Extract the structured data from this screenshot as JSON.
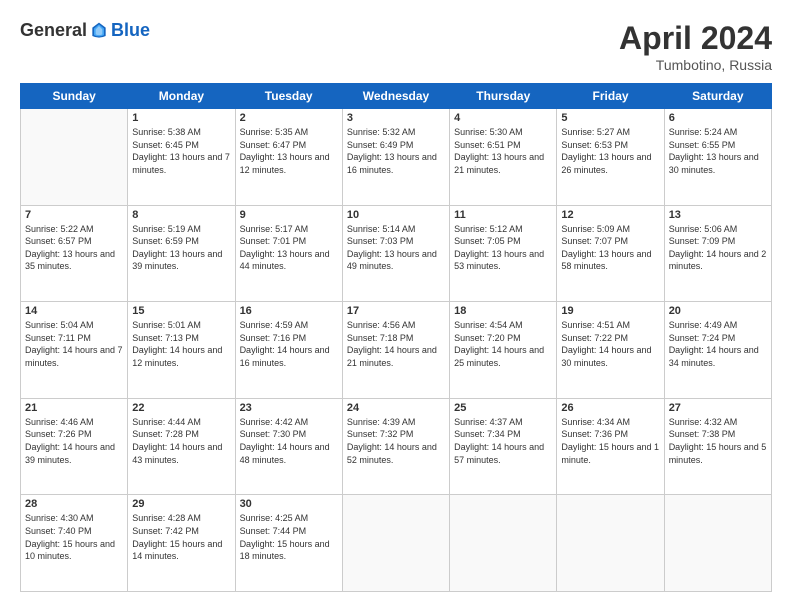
{
  "logo": {
    "general": "General",
    "blue": "Blue"
  },
  "title": "April 2024",
  "location": "Tumbotino, Russia",
  "days_of_week": [
    "Sunday",
    "Monday",
    "Tuesday",
    "Wednesday",
    "Thursday",
    "Friday",
    "Saturday"
  ],
  "weeks": [
    [
      {
        "day": "",
        "sunrise": "",
        "sunset": "",
        "daylight": ""
      },
      {
        "day": "1",
        "sunrise": "Sunrise: 5:38 AM",
        "sunset": "Sunset: 6:45 PM",
        "daylight": "Daylight: 13 hours and 7 minutes."
      },
      {
        "day": "2",
        "sunrise": "Sunrise: 5:35 AM",
        "sunset": "Sunset: 6:47 PM",
        "daylight": "Daylight: 13 hours and 12 minutes."
      },
      {
        "day": "3",
        "sunrise": "Sunrise: 5:32 AM",
        "sunset": "Sunset: 6:49 PM",
        "daylight": "Daylight: 13 hours and 16 minutes."
      },
      {
        "day": "4",
        "sunrise": "Sunrise: 5:30 AM",
        "sunset": "Sunset: 6:51 PM",
        "daylight": "Daylight: 13 hours and 21 minutes."
      },
      {
        "day": "5",
        "sunrise": "Sunrise: 5:27 AM",
        "sunset": "Sunset: 6:53 PM",
        "daylight": "Daylight: 13 hours and 26 minutes."
      },
      {
        "day": "6",
        "sunrise": "Sunrise: 5:24 AM",
        "sunset": "Sunset: 6:55 PM",
        "daylight": "Daylight: 13 hours and 30 minutes."
      }
    ],
    [
      {
        "day": "7",
        "sunrise": "Sunrise: 5:22 AM",
        "sunset": "Sunset: 6:57 PM",
        "daylight": "Daylight: 13 hours and 35 minutes."
      },
      {
        "day": "8",
        "sunrise": "Sunrise: 5:19 AM",
        "sunset": "Sunset: 6:59 PM",
        "daylight": "Daylight: 13 hours and 39 minutes."
      },
      {
        "day": "9",
        "sunrise": "Sunrise: 5:17 AM",
        "sunset": "Sunset: 7:01 PM",
        "daylight": "Daylight: 13 hours and 44 minutes."
      },
      {
        "day": "10",
        "sunrise": "Sunrise: 5:14 AM",
        "sunset": "Sunset: 7:03 PM",
        "daylight": "Daylight: 13 hours and 49 minutes."
      },
      {
        "day": "11",
        "sunrise": "Sunrise: 5:12 AM",
        "sunset": "Sunset: 7:05 PM",
        "daylight": "Daylight: 13 hours and 53 minutes."
      },
      {
        "day": "12",
        "sunrise": "Sunrise: 5:09 AM",
        "sunset": "Sunset: 7:07 PM",
        "daylight": "Daylight: 13 hours and 58 minutes."
      },
      {
        "day": "13",
        "sunrise": "Sunrise: 5:06 AM",
        "sunset": "Sunset: 7:09 PM",
        "daylight": "Daylight: 14 hours and 2 minutes."
      }
    ],
    [
      {
        "day": "14",
        "sunrise": "Sunrise: 5:04 AM",
        "sunset": "Sunset: 7:11 PM",
        "daylight": "Daylight: 14 hours and 7 minutes."
      },
      {
        "day": "15",
        "sunrise": "Sunrise: 5:01 AM",
        "sunset": "Sunset: 7:13 PM",
        "daylight": "Daylight: 14 hours and 12 minutes."
      },
      {
        "day": "16",
        "sunrise": "Sunrise: 4:59 AM",
        "sunset": "Sunset: 7:16 PM",
        "daylight": "Daylight: 14 hours and 16 minutes."
      },
      {
        "day": "17",
        "sunrise": "Sunrise: 4:56 AM",
        "sunset": "Sunset: 7:18 PM",
        "daylight": "Daylight: 14 hours and 21 minutes."
      },
      {
        "day": "18",
        "sunrise": "Sunrise: 4:54 AM",
        "sunset": "Sunset: 7:20 PM",
        "daylight": "Daylight: 14 hours and 25 minutes."
      },
      {
        "day": "19",
        "sunrise": "Sunrise: 4:51 AM",
        "sunset": "Sunset: 7:22 PM",
        "daylight": "Daylight: 14 hours and 30 minutes."
      },
      {
        "day": "20",
        "sunrise": "Sunrise: 4:49 AM",
        "sunset": "Sunset: 7:24 PM",
        "daylight": "Daylight: 14 hours and 34 minutes."
      }
    ],
    [
      {
        "day": "21",
        "sunrise": "Sunrise: 4:46 AM",
        "sunset": "Sunset: 7:26 PM",
        "daylight": "Daylight: 14 hours and 39 minutes."
      },
      {
        "day": "22",
        "sunrise": "Sunrise: 4:44 AM",
        "sunset": "Sunset: 7:28 PM",
        "daylight": "Daylight: 14 hours and 43 minutes."
      },
      {
        "day": "23",
        "sunrise": "Sunrise: 4:42 AM",
        "sunset": "Sunset: 7:30 PM",
        "daylight": "Daylight: 14 hours and 48 minutes."
      },
      {
        "day": "24",
        "sunrise": "Sunrise: 4:39 AM",
        "sunset": "Sunset: 7:32 PM",
        "daylight": "Daylight: 14 hours and 52 minutes."
      },
      {
        "day": "25",
        "sunrise": "Sunrise: 4:37 AM",
        "sunset": "Sunset: 7:34 PM",
        "daylight": "Daylight: 14 hours and 57 minutes."
      },
      {
        "day": "26",
        "sunrise": "Sunrise: 4:34 AM",
        "sunset": "Sunset: 7:36 PM",
        "daylight": "Daylight: 15 hours and 1 minute."
      },
      {
        "day": "27",
        "sunrise": "Sunrise: 4:32 AM",
        "sunset": "Sunset: 7:38 PM",
        "daylight": "Daylight: 15 hours and 5 minutes."
      }
    ],
    [
      {
        "day": "28",
        "sunrise": "Sunrise: 4:30 AM",
        "sunset": "Sunset: 7:40 PM",
        "daylight": "Daylight: 15 hours and 10 minutes."
      },
      {
        "day": "29",
        "sunrise": "Sunrise: 4:28 AM",
        "sunset": "Sunset: 7:42 PM",
        "daylight": "Daylight: 15 hours and 14 minutes."
      },
      {
        "day": "30",
        "sunrise": "Sunrise: 4:25 AM",
        "sunset": "Sunset: 7:44 PM",
        "daylight": "Daylight: 15 hours and 18 minutes."
      },
      {
        "day": "",
        "sunrise": "",
        "sunset": "",
        "daylight": ""
      },
      {
        "day": "",
        "sunrise": "",
        "sunset": "",
        "daylight": ""
      },
      {
        "day": "",
        "sunrise": "",
        "sunset": "",
        "daylight": ""
      },
      {
        "day": "",
        "sunrise": "",
        "sunset": "",
        "daylight": ""
      }
    ]
  ]
}
